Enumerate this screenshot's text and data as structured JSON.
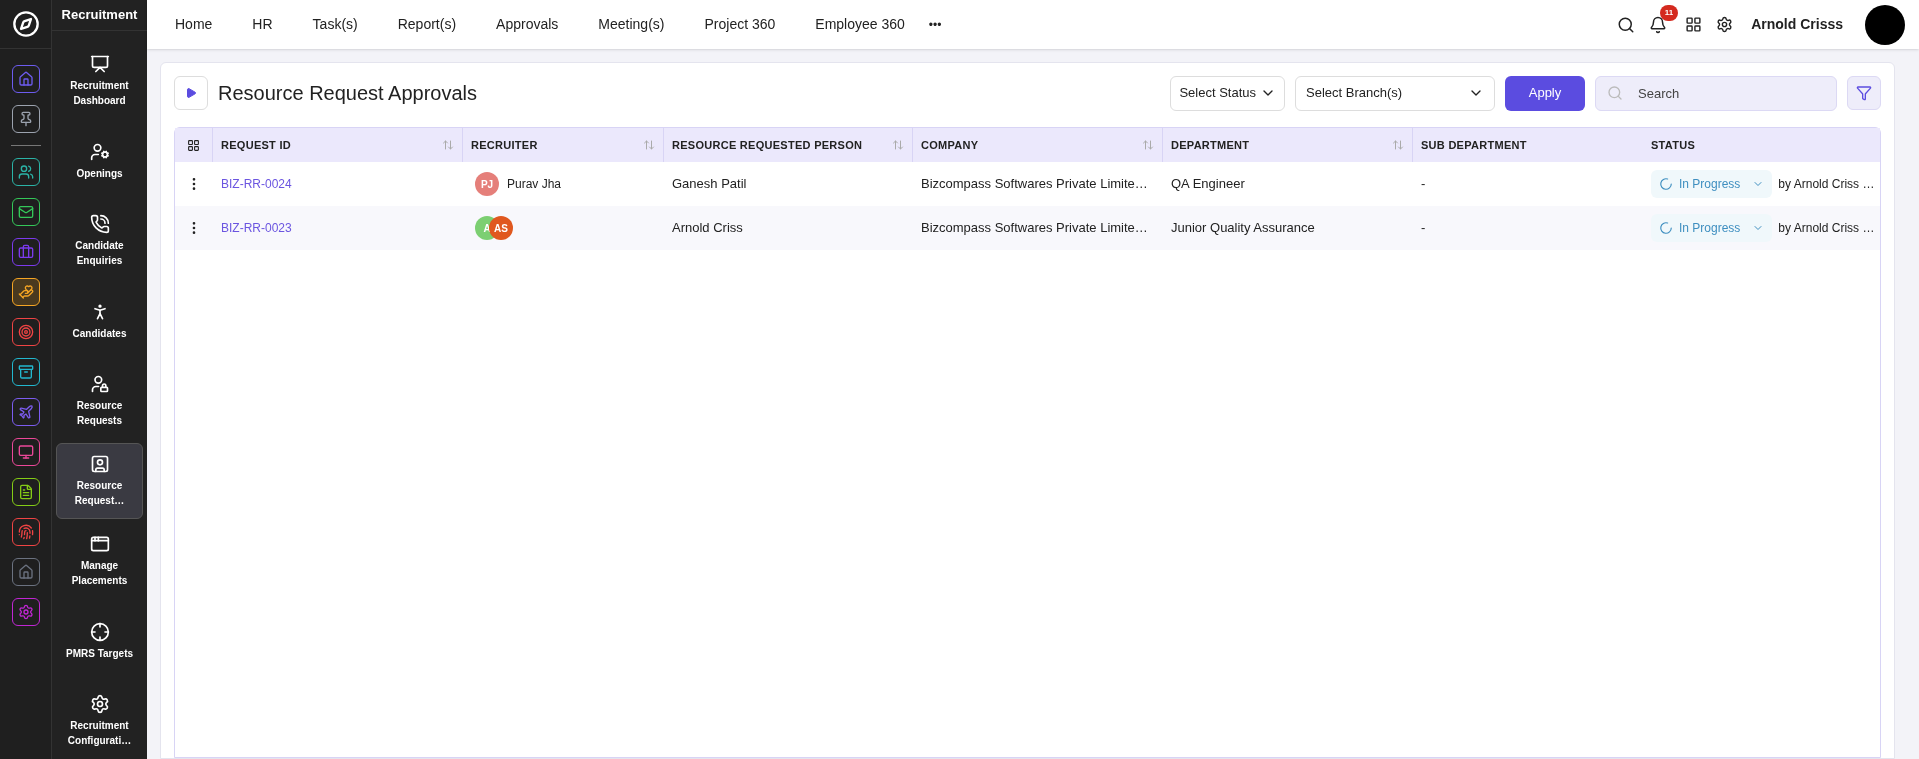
{
  "app": {
    "title": "Recruitment"
  },
  "rail": [
    {
      "color": "#6d5cf0",
      "selected": false
    },
    {
      "color": "#9ca3af",
      "selected": false
    },
    {
      "color": "#2bb3a6",
      "selected": false
    },
    {
      "color": "#34c759",
      "selected": false
    },
    {
      "color": "#7c3aed",
      "selected": false
    },
    {
      "color": "#f5a524",
      "selected": true
    },
    {
      "color": "#ef4444",
      "selected": false
    },
    {
      "color": "#22b8cf",
      "selected": false
    },
    {
      "color": "#7c5cf0",
      "selected": false
    },
    {
      "color": "#ec4899",
      "selected": false
    },
    {
      "color": "#84cc16",
      "selected": false
    },
    {
      "color": "#ef4444",
      "selected": false
    },
    {
      "color": "#6b7280",
      "selected": false
    },
    {
      "color": "#c026d3",
      "selected": false
    }
  ],
  "sidebar": {
    "items": [
      {
        "label": "Recruitment Dashboard",
        "selected": false
      },
      {
        "label": "Openings",
        "selected": false
      },
      {
        "label": "Candidate Enquiries",
        "selected": false
      },
      {
        "label": "Candidates",
        "selected": false
      },
      {
        "label": "Resource Requests",
        "selected": false
      },
      {
        "label": "Resource Request…",
        "selected": true
      },
      {
        "label": "Manage Placements",
        "selected": false
      },
      {
        "label": "PMRS Targets",
        "selected": false
      },
      {
        "label": "Recruitment Configurati…",
        "selected": false
      }
    ]
  },
  "nav": {
    "items": [
      "Home",
      "HR",
      "Task(s)",
      "Report(s)",
      "Approvals",
      "Meeting(s)",
      "Project 360",
      "Employee 360"
    ],
    "more": "•••"
  },
  "header": {
    "notifications": "11",
    "user": "Arnold Crisss"
  },
  "page": {
    "title": "Resource Request Approvals",
    "status_select": "Select Status",
    "branch_select": "Select Branch(s)",
    "apply": "Apply",
    "search": {
      "placeholder": "Search"
    }
  },
  "table": {
    "columns": [
      {
        "label": "REQUEST ID",
        "sortable": true
      },
      {
        "label": "RECRUITER",
        "sortable": true
      },
      {
        "label": "RESOURCE REQUESTED PERSON",
        "sortable": true
      },
      {
        "label": "COMPANY",
        "sortable": true
      },
      {
        "label": "DEPARTMENT",
        "sortable": true
      },
      {
        "label": "SUB DEPARTMENT",
        "sortable": false
      },
      {
        "label": "STATUS",
        "sortable": false
      }
    ],
    "rows": [
      {
        "request_id": "BIZ-RR-0024",
        "recruiters": [
          {
            "initials": "PJ",
            "color": "#e57f7a"
          }
        ],
        "recruiter_name": "Purav Jha",
        "person": "Ganesh Patil",
        "company": "Bizcompass Softwares Private Limite…",
        "department": "QA Engineer",
        "sub_department": "-",
        "status": "In Progress",
        "by": "by Arnold Criss …"
      },
      {
        "request_id": "BIZ-RR-0023",
        "recruiters": [
          {
            "initials": "A",
            "color": "#7ccf72"
          },
          {
            "initials": "AS",
            "color": "#e0581f"
          }
        ],
        "person": "Arnold Criss",
        "company": "Bizcompass Softwares Private Limite…",
        "department": "Junior Quality Assurance",
        "sub_department": "-",
        "status": "In Progress",
        "by": "by Arnold Criss …"
      }
    ]
  }
}
